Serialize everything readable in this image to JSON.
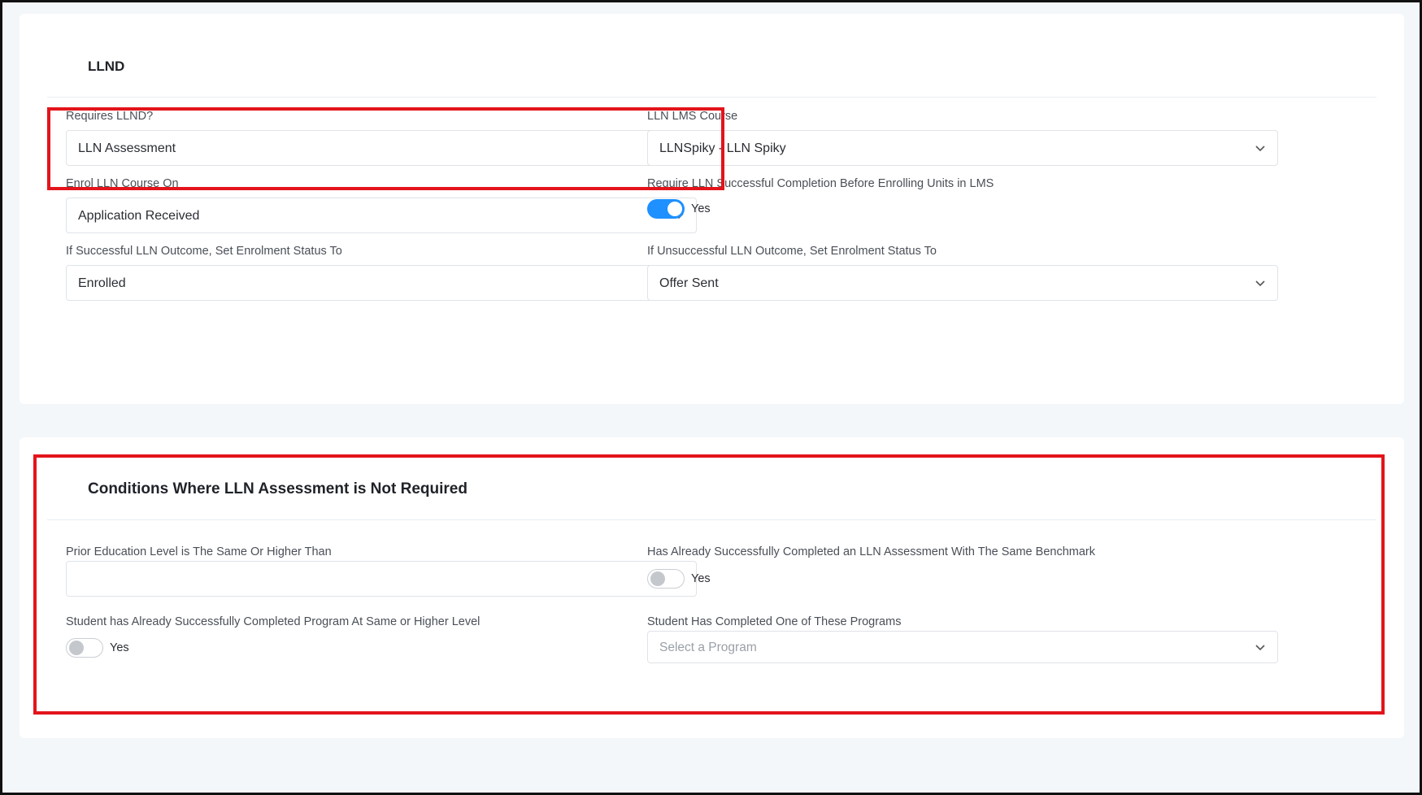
{
  "llnd_section": {
    "title": "LLND",
    "requires_llnd": {
      "label": "Requires LLND?",
      "value": "LLN Assessment"
    },
    "lln_lms_course": {
      "label": "LLN LMS Course",
      "value": "LLNSpiky - LLN Spiky"
    },
    "enrol_lln_course_on": {
      "label": "Enrol LLN Course On",
      "value": "Application Received"
    },
    "require_completion": {
      "label": "Require LLN Successful Completion Before Enrolling Units in LMS",
      "toggle_label": "Yes",
      "enabled": true
    },
    "successful_outcome": {
      "label": "If Successful LLN Outcome, Set Enrolment Status To",
      "value": "Enrolled"
    },
    "unsuccessful_outcome": {
      "label": "If Unsuccessful LLN Outcome, Set Enrolment Status To",
      "value": "Offer Sent"
    }
  },
  "conditions_section": {
    "title": "Conditions Where LLN Assessment is Not Required",
    "prior_education": {
      "label": "Prior Education Level is The Same Or Higher Than",
      "value": ""
    },
    "completed_lln": {
      "label": "Has Already Successfully Completed an LLN Assessment With The Same Benchmark",
      "toggle_label": "Yes",
      "enabled": false
    },
    "completed_program_level": {
      "label": "Student has Already Successfully Completed Program At Same or Higher Level",
      "toggle_label": "Yes",
      "enabled": false
    },
    "completed_programs": {
      "label": "Student Has Completed One of These Programs",
      "placeholder": "Select a Program"
    }
  },
  "colors": {
    "accent": "#1e90ff",
    "highlight": "#e3141b"
  },
  "icons": {
    "dropdown": "chevron-down-icon"
  }
}
